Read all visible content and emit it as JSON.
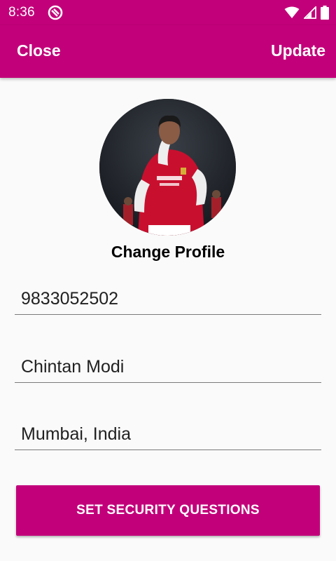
{
  "status_bar": {
    "time": "8:36",
    "icons": [
      "app-notification-icon",
      "wifi-icon",
      "cellular-signal-icon",
      "battery-icon"
    ]
  },
  "toolbar": {
    "close_label": "Close",
    "update_label": "Update",
    "background_color": "#c2007a"
  },
  "profile": {
    "change_profile_label": "Change Profile"
  },
  "form": {
    "phone": "9833052502",
    "name": "Chintan Modi",
    "location": "Mumbai, India"
  },
  "actions": {
    "security_button_label": "SET SECURITY QUESTIONS",
    "accent_color": "#c2007a"
  }
}
